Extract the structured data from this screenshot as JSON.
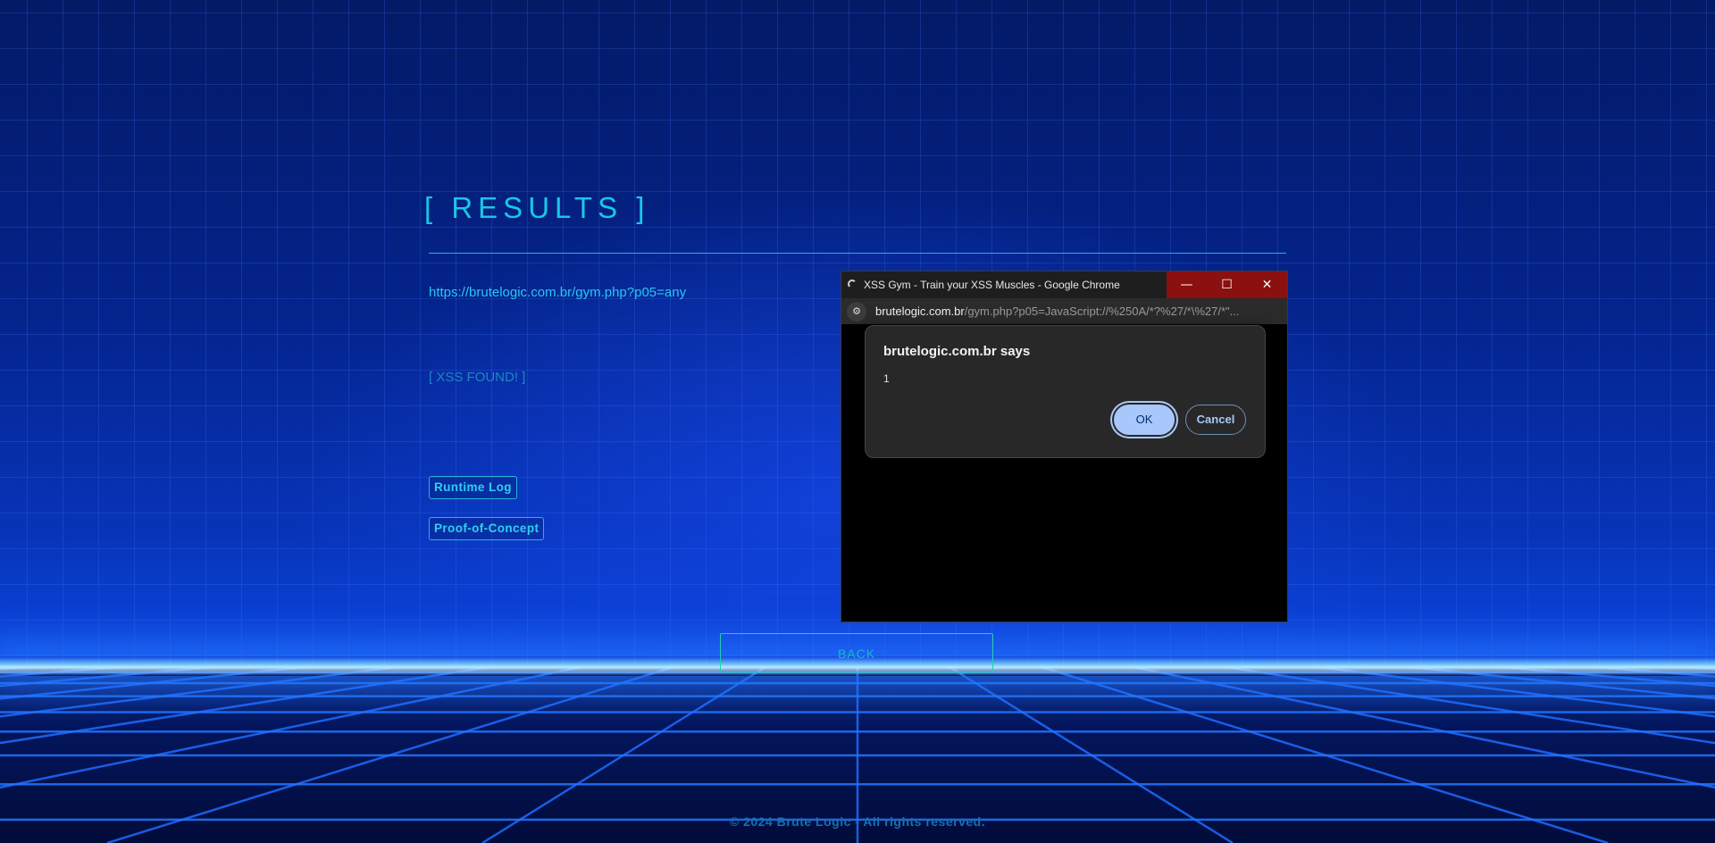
{
  "page": {
    "title": "[ RESULTS ]",
    "url_text": "https://brutelogic.com.br/gym.php?p05=any",
    "status": "[ XSS FOUND! ]",
    "buttons": {
      "runtime_log": "Runtime Log",
      "proof_of_concept": "Proof-of-Concept",
      "back": "BACK"
    },
    "footer": "© 2024 Brute Logic - All rights reserved."
  },
  "popup": {
    "window_title": "XSS Gym - Train your XSS Muscles - Google Chrome",
    "controls": {
      "minimize": "—",
      "maximize": "☐",
      "close": "✕"
    },
    "address": {
      "host": "brutelogic.com.br",
      "path": "/gym.php?p05=JavaScript://%250A/*?%27/*\\%27/*\"..."
    },
    "site_icon": "tune-icon",
    "dialog": {
      "title": "brutelogic.com.br says",
      "message": "1",
      "ok_label": "OK",
      "cancel_label": "Cancel"
    }
  },
  "colors": {
    "accent": "#19c6e6",
    "ok_button": "#a8c7fa",
    "window_controls": "#8b1010"
  }
}
